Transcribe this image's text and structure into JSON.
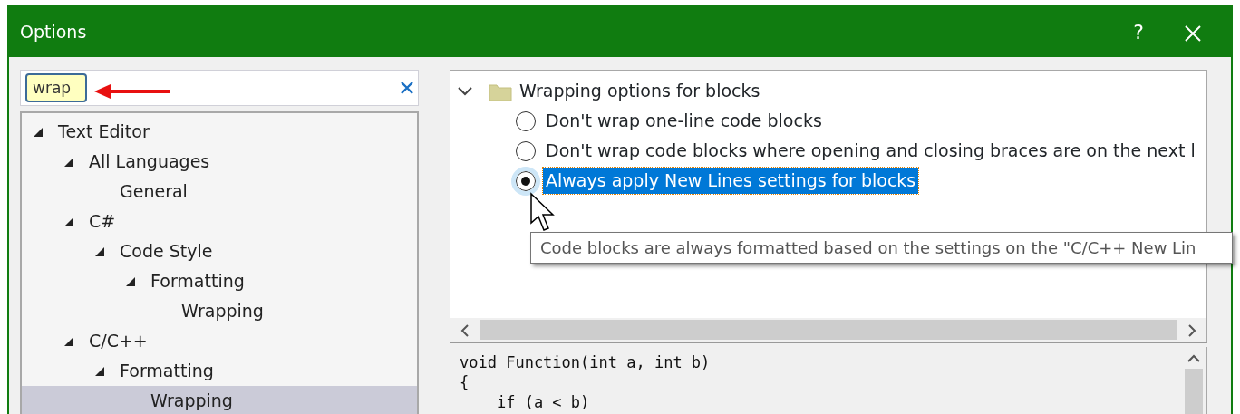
{
  "window": {
    "title": "Options",
    "help_button": "?"
  },
  "search": {
    "value": "wrap"
  },
  "tree": [
    {
      "label": "Text Editor",
      "expanded": true,
      "selected": false,
      "children": [
        {
          "label": "All Languages",
          "expanded": true,
          "selected": false,
          "children": [
            {
              "label": "General",
              "selected": false
            }
          ]
        },
        {
          "label": "C#",
          "expanded": true,
          "selected": false,
          "children": [
            {
              "label": "Code Style",
              "expanded": true,
              "selected": false,
              "children": [
                {
                  "label": "Formatting",
                  "expanded": true,
                  "selected": false,
                  "children": [
                    {
                      "label": "Wrapping",
                      "selected": false
                    }
                  ]
                }
              ]
            }
          ]
        },
        {
          "label": "C/C++",
          "expanded": true,
          "selected": false,
          "children": [
            {
              "label": "Formatting",
              "expanded": true,
              "selected": false,
              "children": [
                {
                  "label": "Wrapping",
                  "selected": true
                }
              ]
            }
          ]
        }
      ]
    }
  ],
  "options_group": {
    "label": "Wrapping options for blocks",
    "expanded": true,
    "options": [
      {
        "label": "Don't wrap one-line code blocks",
        "selected": false
      },
      {
        "label": "Don't wrap code blocks where opening and closing braces are on the next l",
        "selected": false
      },
      {
        "label": "Always apply New Lines settings for blocks",
        "selected": true
      }
    ]
  },
  "tooltip": "Code blocks are always formatted based on the settings on the \"C/C++ New Lin",
  "preview": [
    "void Function(int a, int b)",
    "{",
    "    if (a < b)"
  ]
}
